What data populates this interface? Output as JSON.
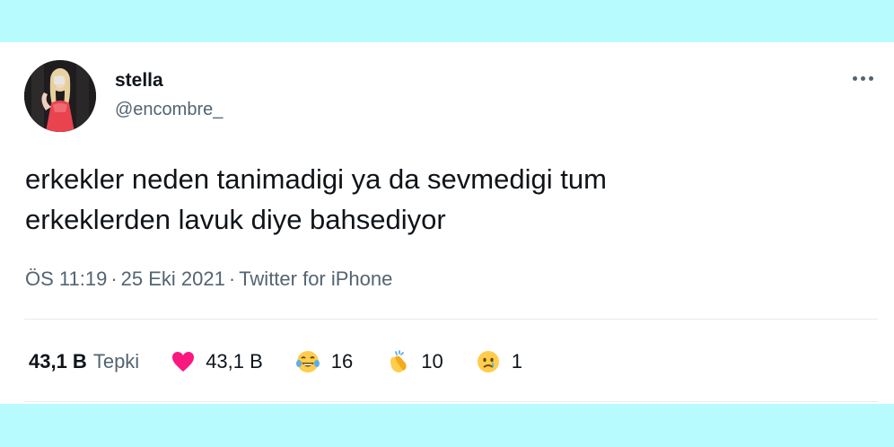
{
  "user": {
    "name": "stella",
    "handle": "@encombre_"
  },
  "tweet": {
    "text_line1": "erkekler neden tanimadigi ya da sevmedigi tum",
    "text_line2": "erkeklerden lavuk diye bahsediyor",
    "time": "ÖS 11:19",
    "date": "25 Eki 2021",
    "separator": "·",
    "source": "Twitter for iPhone"
  },
  "stats": {
    "total": "43,1 B",
    "total_label": "Tepki",
    "reactions": [
      {
        "icon": "heart-icon",
        "count": "43,1 B"
      },
      {
        "icon": "laughing-tears-icon",
        "count": "16"
      },
      {
        "icon": "clapping-hands-icon",
        "count": "10"
      },
      {
        "icon": "crying-face-icon",
        "count": "1"
      }
    ]
  },
  "colors": {
    "page_background": "#b8fbfe",
    "card_background": "#ffffff",
    "text_primary": "#0f1419",
    "text_secondary": "#536471",
    "heart": "#f91880"
  }
}
